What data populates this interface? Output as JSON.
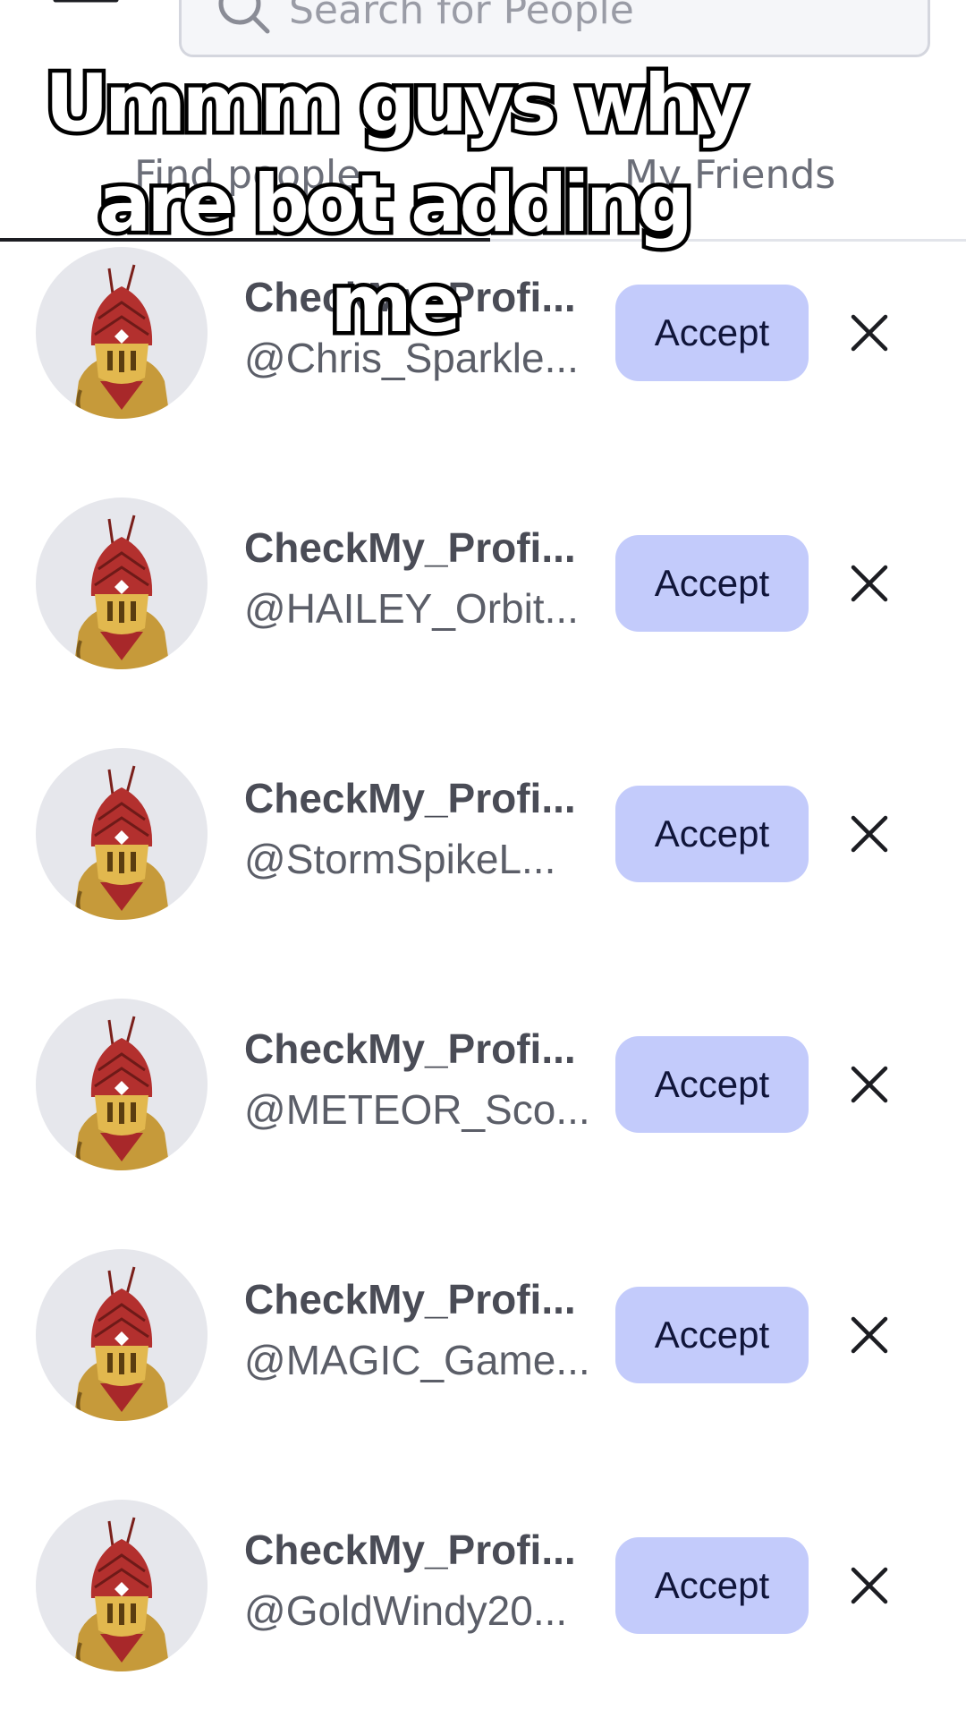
{
  "header": {
    "search_placeholder": "Search for People"
  },
  "tabs": [
    {
      "label": "Find people",
      "active": true
    },
    {
      "label": "My Friends",
      "active": false
    }
  ],
  "caption": {
    "line1": "Ummm guys why",
    "line2": "are bot adding me"
  },
  "requests": [
    {
      "display_name": "CheckMy_Profi...",
      "username": "@Chris_Sparkle...",
      "accept_label": "Accept"
    },
    {
      "display_name": "CheckMy_Profi...",
      "username": "@HAILEY_Orbit...",
      "accept_label": "Accept"
    },
    {
      "display_name": "CheckMy_Profi...",
      "username": "@StormSpikeL...",
      "accept_label": "Accept"
    },
    {
      "display_name": "CheckMy_Profi...",
      "username": "@METEOR_Sco...",
      "accept_label": "Accept"
    },
    {
      "display_name": "CheckMy_Profi...",
      "username": "@MAGIC_Game...",
      "accept_label": "Accept"
    },
    {
      "display_name": "CheckMy_Profi...",
      "username": "@GoldWindy20...",
      "accept_label": "Accept"
    }
  ],
  "colors": {
    "accept_bg": "#c3cbfb",
    "accept_text": "#10153a",
    "tab_active_underline": "#1c1d22"
  }
}
